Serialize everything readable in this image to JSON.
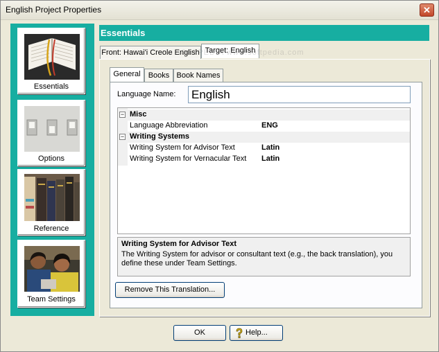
{
  "window": {
    "title": "English Project Properties"
  },
  "sidebar": {
    "items": [
      {
        "label": "Essentials",
        "icon": "open-book-icon"
      },
      {
        "label": "Options",
        "icon": "switches-icon"
      },
      {
        "label": "Reference",
        "icon": "books-shelf-icon"
      },
      {
        "label": "Team Settings",
        "icon": "team-photo-icon"
      }
    ]
  },
  "panel": {
    "title": "Essentials",
    "outer_tabs": [
      "Front: Hawai'i Creole English",
      "Target: English"
    ],
    "inner_tabs": [
      "General",
      "Books",
      "Book Names"
    ]
  },
  "general": {
    "language_name_label": "Language Name:",
    "language_name_value": "English"
  },
  "properties": {
    "misc_category": "Misc",
    "language_abbreviation_label": "Language Abbreviation",
    "language_abbreviation_value": "ENG",
    "writing_systems_category": "Writing Systems",
    "advisor_label": "Writing System for Advisor Text",
    "advisor_value": "Latin",
    "vernacular_label": "Writing System for Vernacular Text",
    "vernacular_value": "Latin"
  },
  "help": {
    "title": "Writing System for Advisor Text",
    "description": "The Writing System for advisor or consultant text (e.g., the back translation), you define these under Team Settings."
  },
  "buttons": {
    "remove_translation": "Remove This Translation...",
    "ok": "OK",
    "help": "Help..."
  },
  "watermark": "SOFTPEDIA www.softpedia.com",
  "colors": {
    "accent": "#17aea1",
    "window_bg": "#ece9d8"
  }
}
